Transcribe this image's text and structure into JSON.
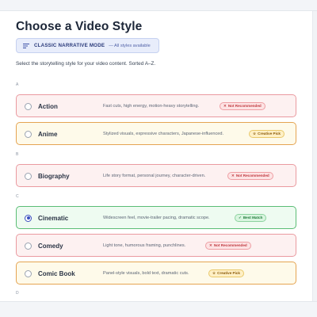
{
  "page": {
    "title": "Choose a Video Style",
    "mode": {
      "label": "CLASSIC NARRATIVE MODE",
      "sub": "— All styles available",
      "icon": "menu-lines-icon"
    },
    "instructions": "Select the storytelling style for your video content. Sorted A–Z."
  },
  "groups": {
    "a": "A",
    "b": "B",
    "c": "C",
    "d": "D"
  },
  "styles": [
    {
      "name": "Action",
      "description": "Fast cuts, high energy, motion-heavy storytelling.",
      "badge": "Not Recommended",
      "badge_icon": "✕",
      "kind": "not-rec",
      "selected": false
    },
    {
      "name": "Anime",
      "description": "Stylized visuals, expressive characters, Japanese-influenced.",
      "badge": "Creative Pick",
      "badge_icon": "☆",
      "kind": "creative",
      "selected": false
    },
    {
      "name": "Biography",
      "description": "Life story format, personal journey, character-driven.",
      "badge": "Not Recommended",
      "badge_icon": "✕",
      "kind": "not-rec",
      "selected": false
    },
    {
      "name": "Cinematic",
      "description": "Widescreen feel, movie-trailer pacing, dramatic scope.",
      "badge": "Best Match",
      "badge_icon": "✓",
      "kind": "best",
      "selected": true
    },
    {
      "name": "Comedy",
      "description": "Light tone, humorous framing, punchlines.",
      "badge": "Not Recommended",
      "badge_icon": "✕",
      "kind": "not-rec",
      "selected": false
    },
    {
      "name": "Comic Book",
      "description": "Panel-style visuals, bold text, dramatic cuts.",
      "badge": "Creative Pick",
      "badge_icon": "☆",
      "kind": "creative",
      "selected": false
    }
  ],
  "colors": {
    "not_recommended_border": "#ea9aa0",
    "creative_border": "#e5a452",
    "best_match_border": "#5bbd75",
    "selected_radio": "#3a4fbf"
  }
}
